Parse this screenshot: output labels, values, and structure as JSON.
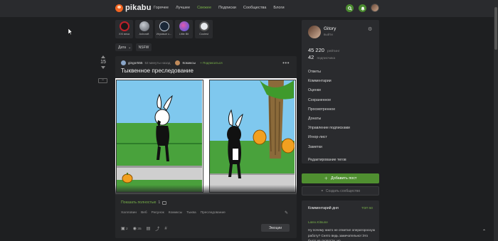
{
  "header": {
    "logo_text": "pikabu",
    "nav": [
      "Горячее",
      "Лучшее",
      "Свежее",
      "Подписки",
      "Сообщества",
      "Блоги"
    ],
    "active_nav_index": 2,
    "accent_color": "#79b24a"
  },
  "communities": [
    {
      "label": "XXI века",
      "color": "#c0202a"
    },
    {
      "label": "Ashcraft",
      "color": "#9aa0a8"
    },
    {
      "label": "Игровые с...",
      "color": "#1b2838"
    },
    {
      "label": "Little Bit",
      "color": "#5a7adf"
    },
    {
      "label": "Coolest",
      "color": "#d9dde2"
    }
  ],
  "filters": {
    "date_label": "Дата",
    "nsfw_label": "NSFW"
  },
  "story": {
    "rating": "15",
    "minus_label": "−",
    "author": "gingor555",
    "time": "53 минуты назад",
    "community": "Комиксы",
    "subscribe": "Подписаться",
    "title": "Тыквенное преследование",
    "show_full": "Показать полностью",
    "image_count": "1",
    "tags": [
      "Халловин",
      "Веб",
      "Рисунок",
      "Комиксы",
      "Тыква",
      "Преследование"
    ],
    "comments": "2",
    "views": "35",
    "emoji_label": "Эмоции"
  },
  "profile": {
    "name": "Gitory",
    "exit": "выйти",
    "rating_value": "45 220",
    "rating_label": "рейтинг",
    "subs_value": "42",
    "subs_label": "подписчика",
    "menu": [
      "Ответы",
      "Комментарии",
      "Оценки",
      "Сохраненное",
      "Просмотренное",
      "Донаты",
      "Управление подписками",
      "Игнор-лист",
      "Заметки"
    ],
    "edit_tags": "Редактирование тегов",
    "add_post": "Добавить пост",
    "create_community": "Создать сообщество"
  },
  "comment_of_day": {
    "title": "Комментарий дня",
    "top": "ТОП 50",
    "author": "Latex.Kitsune",
    "text": "Ну почему никто не отметил оператороскую работу? Снято ведь замечательно! Это было на скорости, но"
  }
}
